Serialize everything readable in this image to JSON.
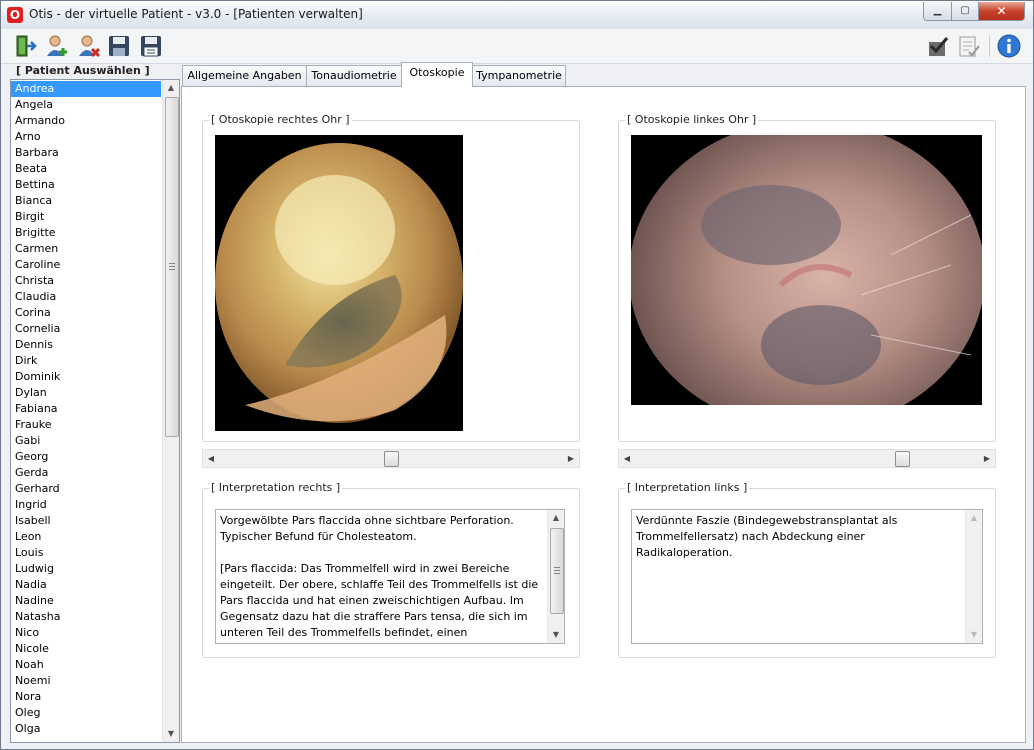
{
  "window": {
    "app_icon_glyph": "O",
    "title": "Otis - der virtuelle Patient - v3.0 - [Patienten verwalten]",
    "min_glyph": "▁",
    "max_glyph": "▢",
    "close_glyph": "✕"
  },
  "toolbar": {
    "left_icons": [
      "exit-door-icon",
      "add-patient-icon",
      "remove-patient-icon",
      "save-icon",
      "save-as-icon"
    ],
    "right_icons": [
      "check-grade-icon",
      "checklist-icon",
      "info-icon"
    ]
  },
  "patients": {
    "title": "[ Patient Auswählen ]",
    "selected": "Andrea",
    "names": [
      "Andrea",
      "Angela",
      "Armando",
      "Arno",
      "Barbara",
      "Beata",
      "Bettina",
      "Bianca",
      "Birgit",
      "Brigitte",
      "Carmen",
      "Caroline",
      "Christa",
      "Claudia",
      "Corina",
      "Cornelia",
      "Dennis",
      "Dirk",
      "Dominik",
      "Dylan",
      "Fabiana",
      "Frauke",
      "Gabi",
      "Georg",
      "Gerda",
      "Gerhard",
      "Ingrid",
      "Isabell",
      "Leon",
      "Louis",
      "Ludwig",
      "Nadia",
      "Nadine",
      "Natasha",
      "Nico",
      "Nicole",
      "Noah",
      "Noemi",
      "Nora",
      "Oleg",
      "Olga"
    ]
  },
  "tabs": [
    {
      "label": "Allgemeine Angaben",
      "active": false
    },
    {
      "label": "Tonaudiometrie",
      "active": false
    },
    {
      "label": "Otoskopie",
      "active": true
    },
    {
      "label": "Tympanometrie",
      "active": false
    }
  ],
  "otoskopie": {
    "right": {
      "title": "[ Otoskopie rechtes Ohr ]",
      "interpretation_title": "[ Interpretation rechts ]",
      "interpretation_text": "Vorgewölbte Pars flaccida ohne sichtbare Perforation. Typischer Befund für Cholesteatom.\n\n[Pars flaccida: Das Trommelfell wird in zwei Bereiche eingeteilt. Der obere, schlaffe Teil des Trommelfells ist die Pars flaccida und hat einen zweischichtigen Aufbau. Im Gegensatz dazu hat die straffere Pars tensa, die sich im unteren Teil des Trommelfells befindet, einen",
      "slider_value": 0.5
    },
    "left": {
      "title": "[ Otoskopie linkes Ohr ]",
      "interpretation_title": "[ Interpretation links ]",
      "interpretation_text": "Verdünnte Faszie (Bindegewebstransplantat als Trommelfellersatz) nach Abdeckung einer Radikaloperation.",
      "slider_value": 0.79
    }
  },
  "colors": {
    "selection": "#3399ff",
    "close_button": "#c7432c"
  }
}
